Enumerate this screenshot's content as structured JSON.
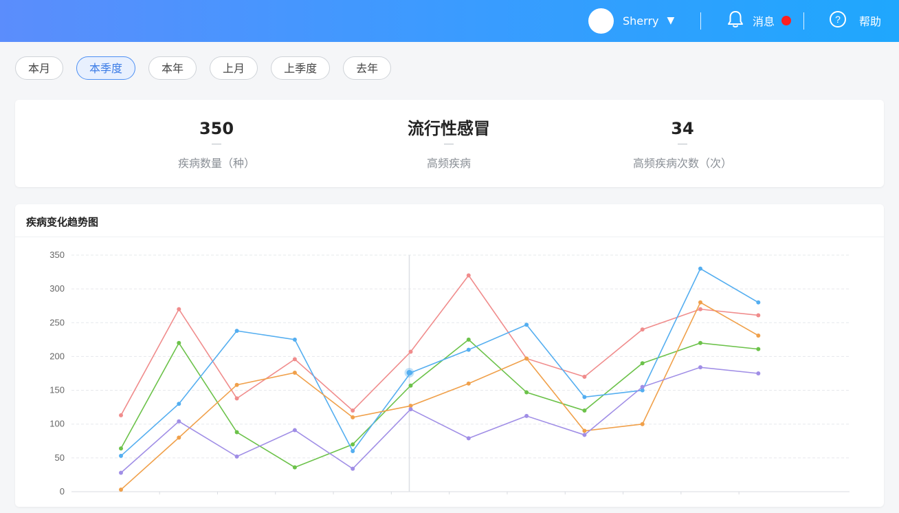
{
  "header": {
    "user_name": "Sherry",
    "caret": "▼",
    "messages_label": "消息",
    "help_label": "帮助",
    "help_glyph": "?",
    "accent_start": "#5b8dfc",
    "accent_end": "#1fa7fd",
    "notification_color": "#ff1f1f"
  },
  "filters": {
    "items": [
      "本月",
      "本季度",
      "本年",
      "上月",
      "上季度",
      "去年"
    ],
    "selected": "本季度"
  },
  "stats": [
    {
      "value": "350",
      "label": "疾病数量（种）"
    },
    {
      "value": "流行性感冒",
      "label": "高频疾病"
    },
    {
      "value": "34",
      "label": "高频疾病次数（次）"
    }
  ],
  "chart_card": {
    "title": "疾病变化趋势图"
  },
  "chart_data": {
    "type": "line",
    "title": "",
    "xlabel": "",
    "ylabel": "",
    "ylim": [
      0,
      350
    ],
    "yticks": [
      0,
      50,
      100,
      150,
      200,
      250,
      300,
      350
    ],
    "grid": true,
    "x": [
      1,
      2,
      3,
      4,
      5,
      6,
      7,
      8,
      9,
      10,
      11,
      12
    ],
    "hover_index": 5,
    "series": [
      {
        "color": "#f08c8c",
        "values": [
          113,
          270,
          138,
          196,
          120,
          207,
          320,
          197,
          170,
          240,
          270,
          261
        ]
      },
      {
        "color": "#6cc24a",
        "values": [
          64,
          220,
          88,
          36,
          70,
          157,
          225,
          147,
          120,
          190,
          220,
          211
        ]
      },
      {
        "color": "#54aef0",
        "values": [
          53,
          130,
          238,
          225,
          60,
          176,
          210,
          247,
          140,
          150,
          330,
          280
        ]
      },
      {
        "color": "#f0a04a",
        "values": [
          3,
          80,
          158,
          176,
          110,
          127,
          160,
          197,
          90,
          100,
          280,
          231
        ]
      },
      {
        "color": "#a08ee6",
        "values": [
          28,
          104,
          52,
          91,
          34,
          122,
          79,
          112,
          84,
          155,
          184,
          175
        ]
      }
    ]
  }
}
